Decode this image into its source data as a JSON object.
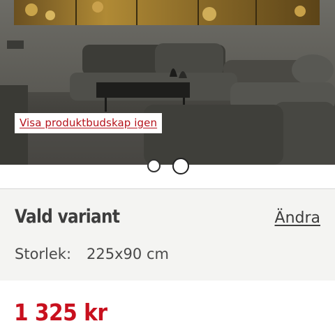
{
  "gallery": {
    "image_alt": "Canvas print above a dark grey sectional sofa in a concrete living room",
    "overlay_link": "Visa produktbudskap igen",
    "slide_count": 2,
    "active_slide": 2
  },
  "variant": {
    "title": "Vald variant",
    "change_label": "Ändra",
    "size_label": "Storlek:",
    "size_value": "225x90 cm"
  },
  "price": {
    "amount": "1 325 kr"
  },
  "colors": {
    "price_red": "#c8101e",
    "link_red": "#b5121b",
    "panel_bg": "#f4f4f2",
    "text_dark": "#3d3d3d"
  }
}
